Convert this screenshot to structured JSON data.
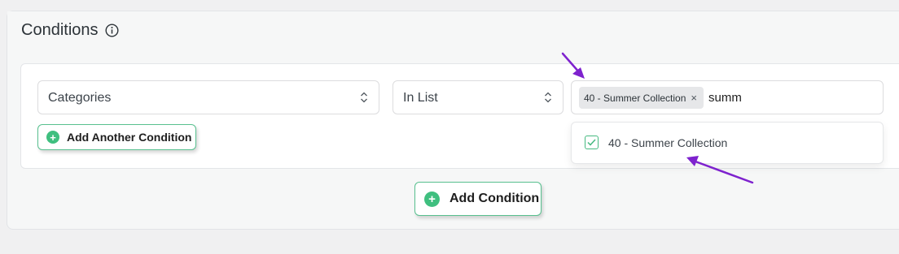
{
  "panel": {
    "title": "Conditions",
    "info_icon": "info-icon"
  },
  "condition_row": {
    "field_select": {
      "value": "Categories",
      "icon": "updown-chevron-icon"
    },
    "operator_select": {
      "value": "In List",
      "icon": "updown-chevron-icon"
    },
    "value_input": {
      "selected_tags": [
        {
          "label": "40 - Summer Collection",
          "remove_symbol": "×"
        }
      ],
      "typed_text": "summ"
    },
    "dropdown": {
      "options": [
        {
          "label": "40 - Summer Collection",
          "checked": true
        }
      ]
    },
    "add_another_label": "Add Another Condition",
    "add_another_symbol": "+"
  },
  "add_condition_label": "Add Condition",
  "add_condition_symbol": "+",
  "colors": {
    "accent_green": "#3fbf7f",
    "annotation_arrow": "#7e22ce"
  }
}
